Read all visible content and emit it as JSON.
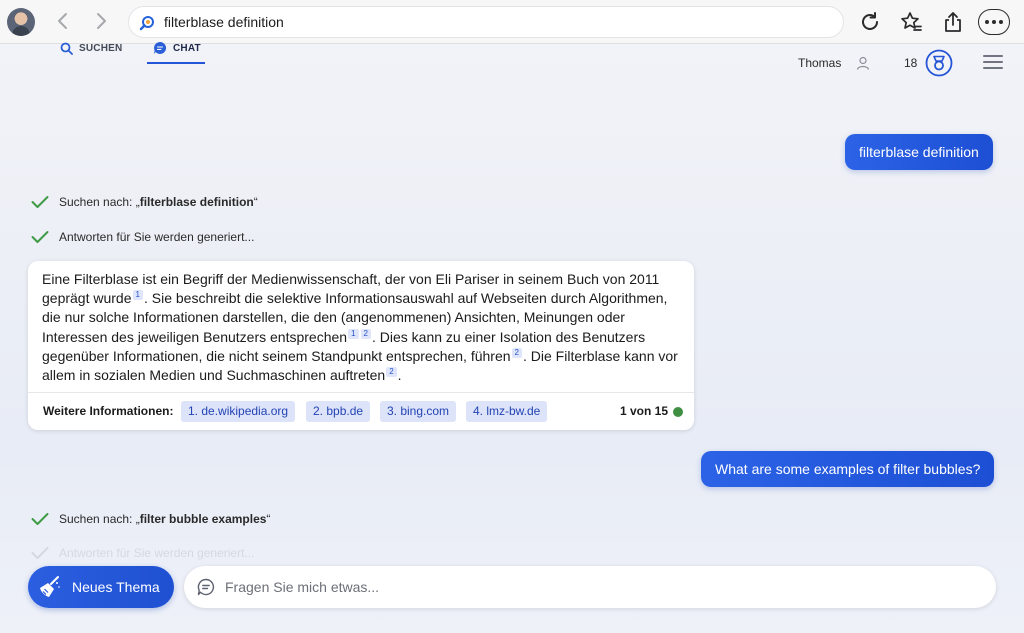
{
  "browser": {
    "url": "filterblase definition"
  },
  "header": {
    "tabs": [
      {
        "label": "SUCHEN"
      },
      {
        "label": "CHAT"
      }
    ],
    "user_name": "Thomas",
    "points": "18"
  },
  "chat": {
    "user_messages": [
      "filterblase definition",
      "What are some examples of filter bubbles?"
    ],
    "status": {
      "search1_prefix": "Suchen nach: „",
      "search1_query": "filterblase definition",
      "search1_suffix": "“",
      "generating": "Antworten für Sie werden generiert...",
      "search2_prefix": "Suchen nach: „",
      "search2_query": "filter bubble examples",
      "search2_suffix": "“",
      "generating_faded": "Antworten für Sie werden generiert..."
    },
    "answer": {
      "p1": "Eine Filterblase ist ein Begriff der Medienwissenschaft, der von Eli Pariser in seinem Buch von 2011 geprägt wurde",
      "r1": "1",
      "p2": ". Sie beschreibt die selektive Informationsauswahl auf Webseiten durch Algorithmen, die nur solche Informationen darstellen, die den (angenommenen) Ansichten, Meinungen oder Interessen des jeweiligen Benutzers entsprechen",
      "r2": "1",
      "r3": "2",
      "p3": ". Dies kann zu einer Isolation des Benutzers gegenüber Informationen, die nicht seinem Standpunkt entsprechen, führen",
      "r4": "2",
      "p4": ". Die Filterblase kann vor allem in sozialen Medien und Suchmaschinen auftreten",
      "r5": "2",
      "p5": "."
    },
    "more_info_label": "Weitere Informationen:",
    "sources": [
      "1. de.wikipedia.org",
      "2. bpb.de",
      "3. bing.com",
      "4. lmz-bw.de"
    ],
    "pager": "1 von 15",
    "pager_color": "#3f8f43"
  },
  "bottom": {
    "new_topic_label": "Neues Thema",
    "ask_placeholder": "Fragen Sie mich etwas..."
  },
  "icons": {
    "back": "chevron-left-icon",
    "forward": "chevron-right-icon",
    "reload": "reload-icon",
    "favorites": "star-list-icon",
    "share": "share-icon",
    "more": "more-icon",
    "user": "user-icon",
    "rewards": "rewards-medal-icon",
    "menu": "hamburger-menu-icon",
    "new_topic": "broom-icon",
    "ask": "chat-bubble-icon"
  },
  "colors": {
    "accent": "#2455d6",
    "source_chip_bg": "#dde3f8"
  }
}
